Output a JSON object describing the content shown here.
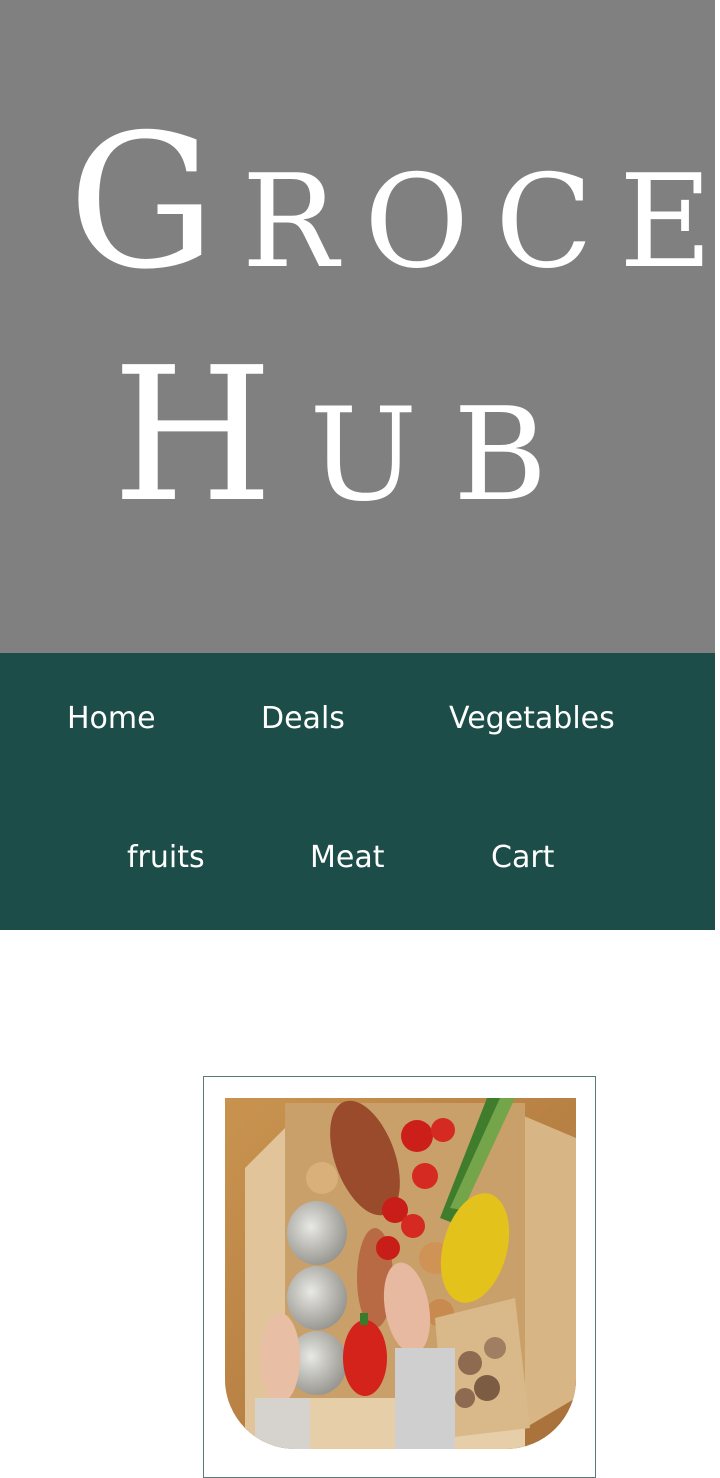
{
  "hero": {
    "line1": {
      "initial": "G",
      "rest": "ROCE"
    },
    "line2": {
      "initial": "H",
      "rest": "UB"
    },
    "bg_color": "#808080"
  },
  "nav": {
    "bg_color": "#1c4d48",
    "items": [
      {
        "label": "Home"
      },
      {
        "label": "Deals"
      },
      {
        "label": "Vegetables"
      },
      {
        "label": "fruits"
      },
      {
        "label": "Meat"
      },
      {
        "label": "Cart"
      }
    ]
  },
  "card": {
    "image_icon": "grocery-box-photo"
  }
}
